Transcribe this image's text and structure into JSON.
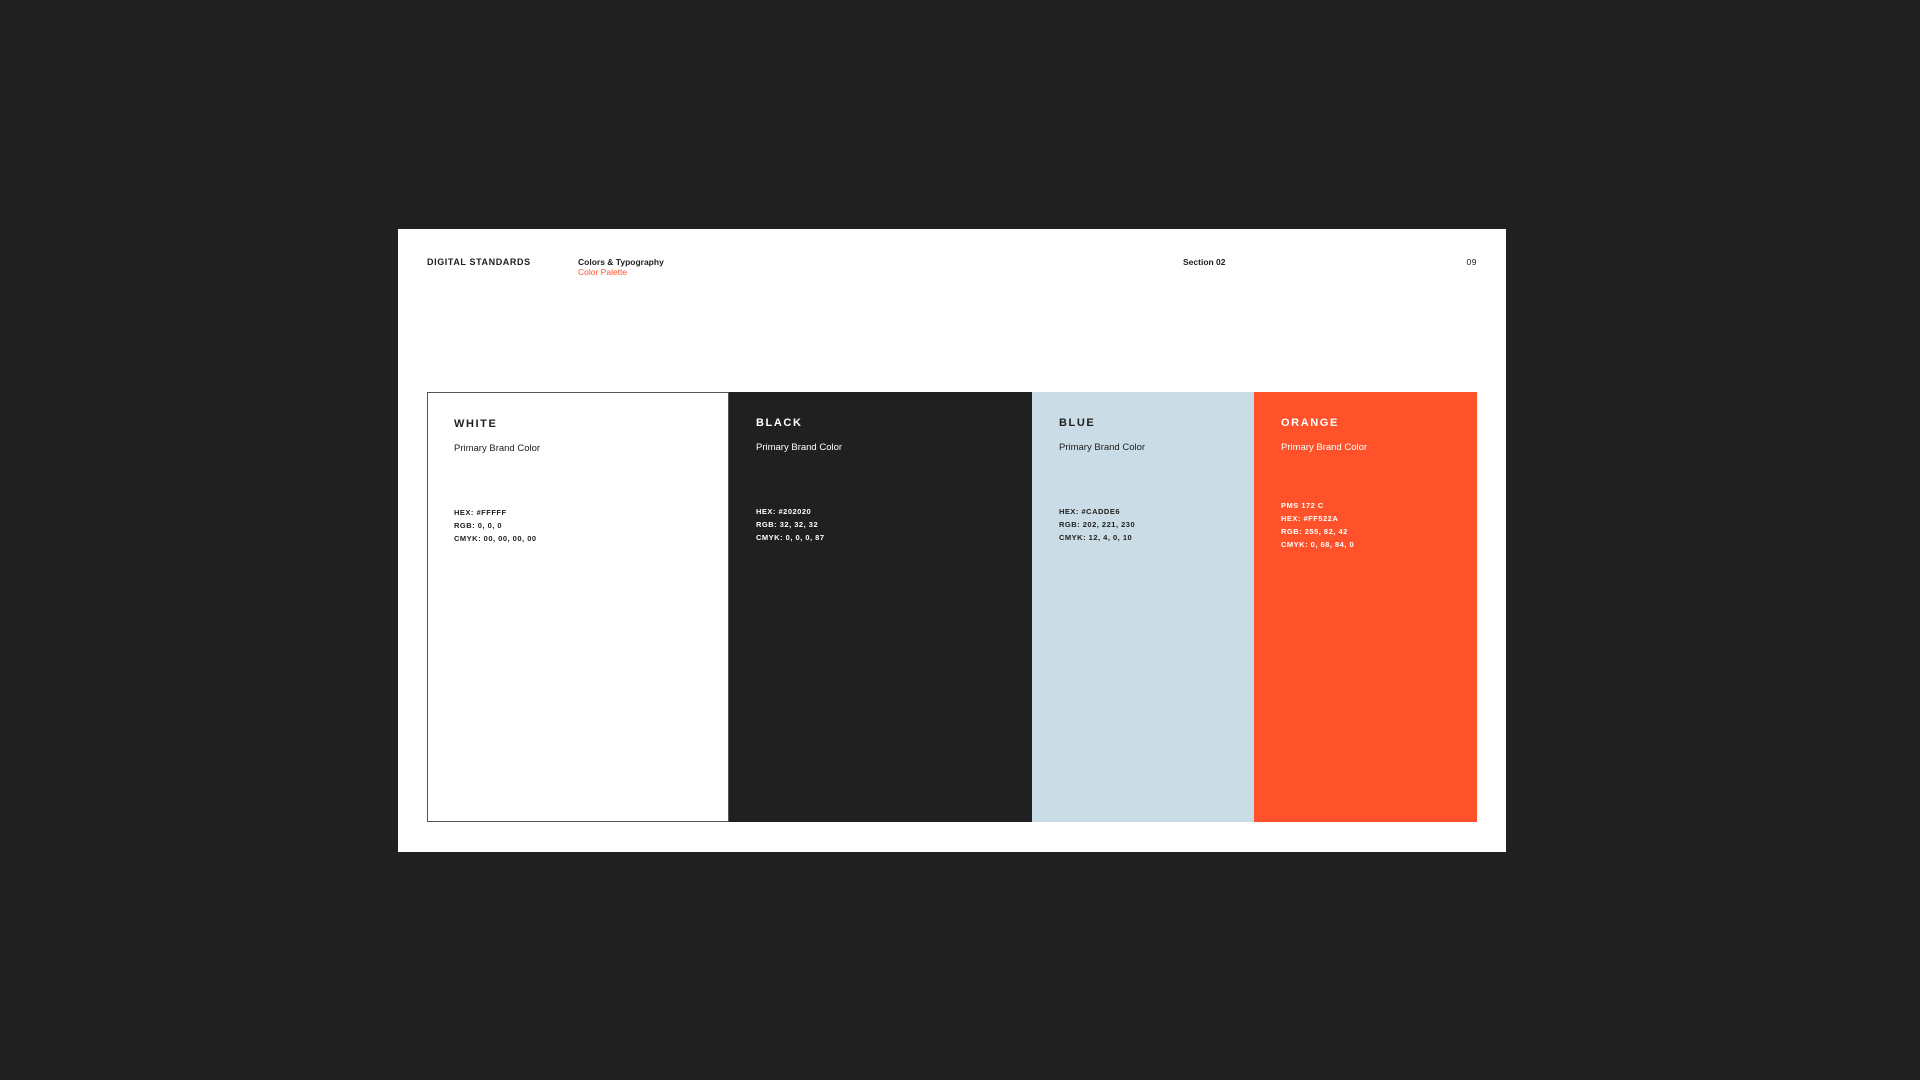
{
  "header": {
    "brand": "DIGITAL STANDARDS",
    "section_title": "Colors & Typography",
    "section_subtitle": "Color Palette",
    "section_label": "Section 02",
    "page_number": "09"
  },
  "colors": {
    "background": "#202020",
    "page": "#FFFFFF",
    "accent": "#FF522A"
  },
  "swatches": [
    {
      "name": "WHITE",
      "description": "Primary Brand Color",
      "color": "#FFFFFF",
      "specs": [
        "HEX: #FFFFF",
        "RGB: 0, 0, 0",
        "CMYK: 00, 00, 00, 00"
      ]
    },
    {
      "name": "BLACK",
      "description": "Primary Brand Color",
      "color": "#202020",
      "specs": [
        "HEX: #202020",
        "RGB: 32, 32, 32",
        "CMYK: 0, 0, 0, 87"
      ]
    },
    {
      "name": "BLUE",
      "description": "Primary Brand Color",
      "color": "#CADDE6",
      "specs": [
        "HEX: #CADDE6",
        "RGB: 202, 221, 230",
        "CMYK: 12, 4, 0, 10"
      ]
    },
    {
      "name": "ORANGE",
      "description": "Primary Brand Color",
      "color": "#FF522A",
      "specs": [
        "PMS 172 C",
        "HEX: #FF522A",
        "RGB: 255, 82, 42",
        "CMYK: 0, 68, 84, 0"
      ]
    }
  ]
}
